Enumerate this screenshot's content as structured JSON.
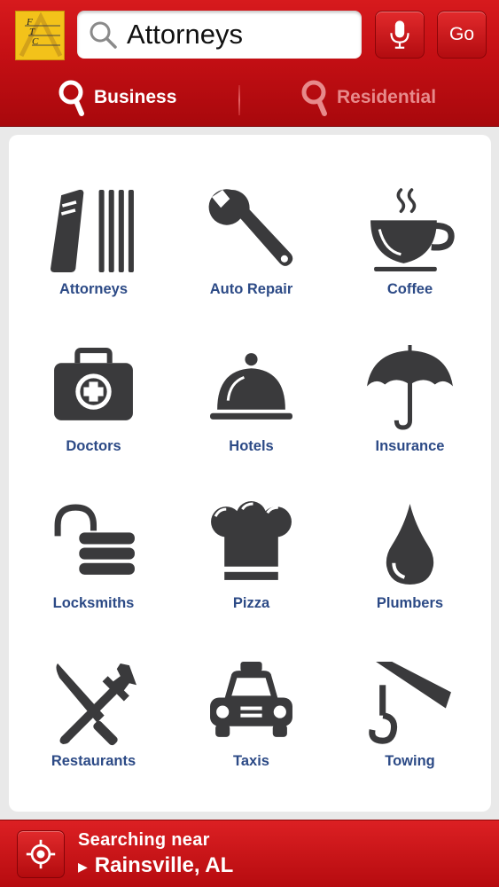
{
  "header": {
    "logo_text": "FTC",
    "search_value": "Attorneys",
    "go_label": "Go",
    "tabs": [
      {
        "label": "Business",
        "active": true
      },
      {
        "label": "Residential",
        "active": false
      }
    ]
  },
  "categories": [
    {
      "label": "Attorneys",
      "icon": "books-icon"
    },
    {
      "label": "Auto Repair",
      "icon": "wrench-icon"
    },
    {
      "label": "Coffee",
      "icon": "coffee-cup-icon"
    },
    {
      "label": "Doctors",
      "icon": "medical-bag-icon"
    },
    {
      "label": "Hotels",
      "icon": "service-bell-icon"
    },
    {
      "label": "Insurance",
      "icon": "umbrella-icon"
    },
    {
      "label": "Locksmiths",
      "icon": "padlock-icon"
    },
    {
      "label": "Pizza",
      "icon": "chef-hat-icon"
    },
    {
      "label": "Plumbers",
      "icon": "water-drop-icon"
    },
    {
      "label": "Restaurants",
      "icon": "knife-fork-icon"
    },
    {
      "label": "Taxis",
      "icon": "taxi-icon"
    },
    {
      "label": "Towing",
      "icon": "tow-hook-icon"
    }
  ],
  "footer": {
    "searching_label": "Searching near",
    "city": "Rainsville, AL"
  },
  "colors": {
    "brand_red": "#c40f14",
    "icon_gray": "#3a3a3c",
    "label_blue": "#2c4a86"
  }
}
